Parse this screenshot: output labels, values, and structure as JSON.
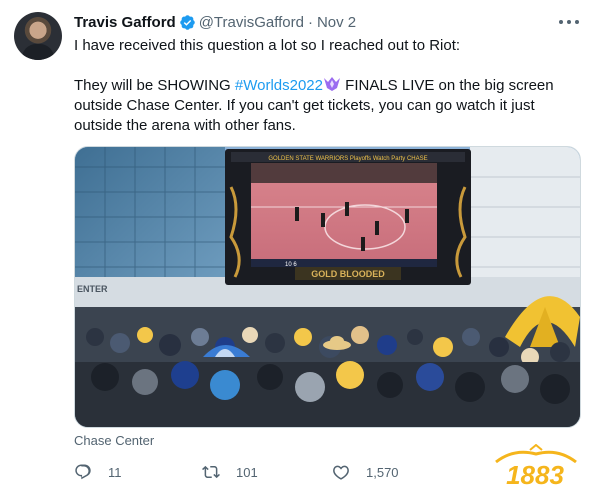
{
  "tweet": {
    "author_name": "Travis Gafford",
    "handle": "@TravisGafford",
    "separator": "·",
    "date": "Nov 2",
    "line1": "I have received this question a lot so I reached out to Riot:",
    "line2_pre": "They will be SHOWING ",
    "hashtag": "#Worlds2022",
    "line2_post": " FINALS LIVE on the big screen",
    "line3": "outside Chase Center. If you can't get tickets, you can go watch it just",
    "line4": "outside the arena with other fans.",
    "media_caption": "Chase Center"
  },
  "media": {
    "screen_header": "GOLDEN STATE WARRIORS  Playoffs Watch Party  CHASE",
    "screen_footer": "GOLD BLOODED",
    "building_sign": "ENTER"
  },
  "actions": {
    "reply_count": "11",
    "retweet_count": "101",
    "like_count": "1,570"
  },
  "watermark": {
    "text": "1883"
  },
  "colors": {
    "text": "#0f1419",
    "secondary": "#536471",
    "link": "#1d9bf0",
    "verified": "#1d9bf0",
    "watermark": "#f5b51c"
  },
  "icons": {
    "verified": "verified-badge-icon",
    "more": "more-icon",
    "reply": "reply-icon",
    "retweet": "retweet-icon",
    "like": "like-icon",
    "emoji": "worlds-emoji-icon"
  }
}
